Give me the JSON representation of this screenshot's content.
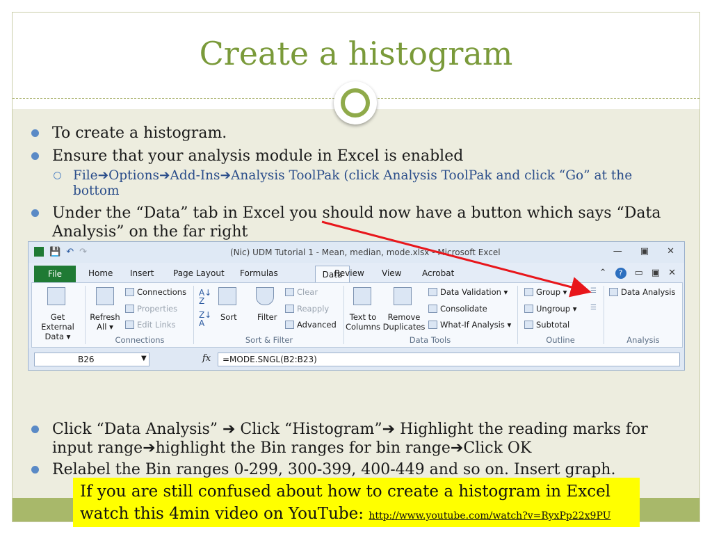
{
  "title": "Create a histogram",
  "bullets": [
    "To create a histogram.",
    "Ensure that your analysis module in Excel is enabled"
  ],
  "sub_bullet": "File➔Options➔Add-Ins➔Analysis ToolPak (click Analysis ToolPak and click “Go” at the bottom",
  "bullet3": "Under the “Data” tab in Excel you should now have a button which says “Data Analysis” on the far right",
  "bullet4": "Click “Data Analysis” ➔ Click “Histogram”➔ Highlight the reading marks for input range➔highlight the Bin ranges for bin range➔Click OK",
  "bullet5": "Relabel the Bin ranges 0-299, 300-399, 400-449 and so on. Insert graph.",
  "callout": {
    "text": "If you are still confused about how to create a histogram in Excel watch this 4min video on YouTube:",
    "link": "http://www.youtube.com/watch?v=RyxPp22x9PU"
  },
  "excel": {
    "window_title": "(Nic) UDM Tutorial 1 - Mean, median, mode.xlsx - Microsoft Excel",
    "tabs": [
      "File",
      "Home",
      "Insert",
      "Page Layout",
      "Formulas",
      "Data",
      "Review",
      "View",
      "Acrobat"
    ],
    "groups": {
      "get_external": "Get External Data ▾",
      "connections_group": "Connections",
      "connections": "Connections",
      "properties": "Properties",
      "edit_links": "Edit Links",
      "refresh": "Refresh All ▾",
      "sort_filter_group": "Sort & Filter",
      "sort": "Sort",
      "filter": "Filter",
      "clear": "Clear",
      "reapply": "Reapply",
      "advanced": "Advanced",
      "data_tools_group": "Data Tools",
      "text_to_columns": "Text to Columns",
      "remove_duplicates": "Remove Duplicates",
      "data_validation": "Data Validation ▾",
      "consolidate": "Consolidate",
      "what_if": "What-If Analysis ▾",
      "outline_group": "Outline",
      "group": "Group ▾",
      "ungroup": "Ungroup ▾",
      "subtotal": "Subtotal",
      "analysis_group": "Analysis",
      "data_analysis": "Data Analysis"
    },
    "name_box": "B26",
    "formula": "=MODE.SNGL(B2:B23)"
  }
}
